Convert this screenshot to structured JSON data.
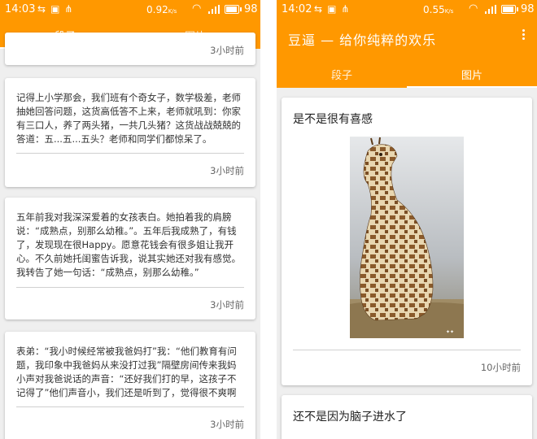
{
  "left": {
    "status": {
      "time": "14:03",
      "percent": "0.92",
      "percent_unit": "K/s",
      "battery": "98",
      "battery_level": 0.98
    },
    "tabs": [
      {
        "label": "段子",
        "active": true
      },
      {
        "label": "图片",
        "active": false
      }
    ],
    "cards": [
      {
        "text": "",
        "time": "3小时前"
      },
      {
        "text": "记得上小学那会，我们班有个奇女子，数学极差，老师抽她回答问题，这货高低答不上来，老师就吼到：你家有三口人，养了两头猪，一共几头猪？这货战战兢兢的答道：五...五...五头？老师和同学们都惊呆了。",
        "time": "3小时前"
      },
      {
        "text": "五年前我对我深深爱着的女孩表白。她拍着我的肩膀说：“成熟点，别那么幼稚。”。五年后我成熟了，有钱了，发现现在很Happy。愿意花钱会有很多姐让我开心。不久前她托闺蜜告诉我，说其实她还对我有感觉。我转告了她一句话：“成熟点，别那么幼稚。”",
        "time": "3小时前"
      },
      {
        "text": "表弟：“我小时候经常被我爸妈打”我：“他们教育有问题，我印象中我爸妈从来没打过我”隔壁房间传来我妈小声对我爸说话的声音：“还好我们打的早，这孩子不记得了”他们声音小，我们还是听到了，觉得很不爽啊",
        "time": "3小时前"
      }
    ]
  },
  "right": {
    "status": {
      "time": "14:02",
      "percent": "0.55",
      "percent_unit": "K/s",
      "battery": "98",
      "battery_level": 0.98
    },
    "title": "豆逼 — 给你纯粹的欢乐",
    "tabs": [
      {
        "label": "段子",
        "active": false
      },
      {
        "label": "图片",
        "active": true
      }
    ],
    "cards": [
      {
        "title": "是不是很有喜感",
        "time": "10小时前"
      },
      {
        "title": "还不是因为脑子进水了",
        "time": ""
      }
    ]
  },
  "colors": {
    "primary": "#ff9800",
    "background": "#efefef",
    "card": "#ffffff"
  }
}
